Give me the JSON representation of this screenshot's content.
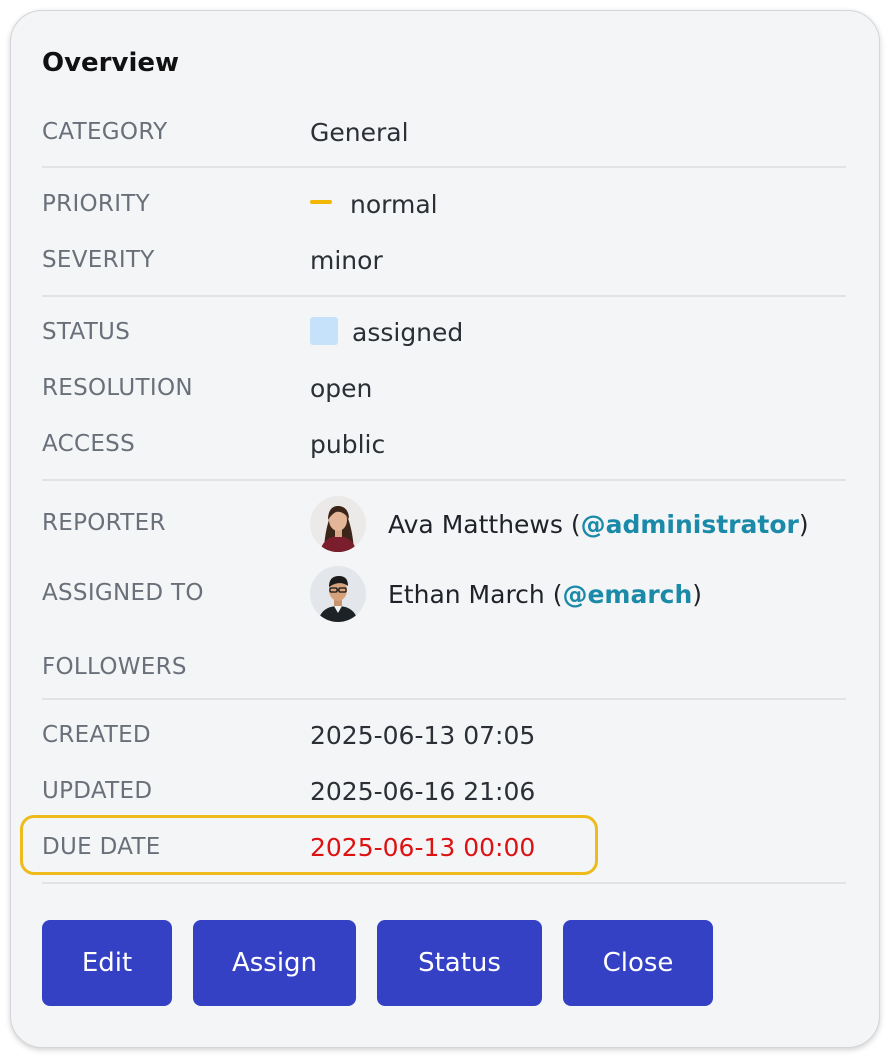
{
  "panel": {
    "title": "Overview"
  },
  "fields": {
    "category": {
      "label": "CATEGORY",
      "value": "General"
    },
    "priority": {
      "label": "PRIORITY",
      "value": "normal",
      "indicator_color": "#f2b705"
    },
    "severity": {
      "label": "SEVERITY",
      "value": "minor"
    },
    "status": {
      "label": "STATUS",
      "value": "assigned",
      "swatch_color": "#c6e1fa"
    },
    "resolution": {
      "label": "RESOLUTION",
      "value": "open"
    },
    "access": {
      "label": "ACCESS",
      "value": "public"
    },
    "reporter": {
      "label": "REPORTER",
      "name": "Ava Matthews",
      "open": " (",
      "handle": "@administrator",
      "close": ")"
    },
    "assigned_to": {
      "label": "ASSIGNED TO",
      "name": "Ethan March",
      "open": " (",
      "handle": "@emarch",
      "close": ")"
    },
    "followers": {
      "label": "FOLLOWERS"
    },
    "created": {
      "label": "CREATED",
      "value": "2025-06-13 07:05"
    },
    "updated": {
      "label": "UPDATED",
      "value": "2025-06-16 21:06"
    },
    "due_date": {
      "label": "DUE DATE",
      "value": "2025-06-13 00:00",
      "value_color": "#dd1313",
      "highlight_color": "#efbb1c"
    }
  },
  "actions": {
    "edit": "Edit",
    "assign": "Assign",
    "status": "Status",
    "close": "Close",
    "button_color": "#3541c4"
  }
}
